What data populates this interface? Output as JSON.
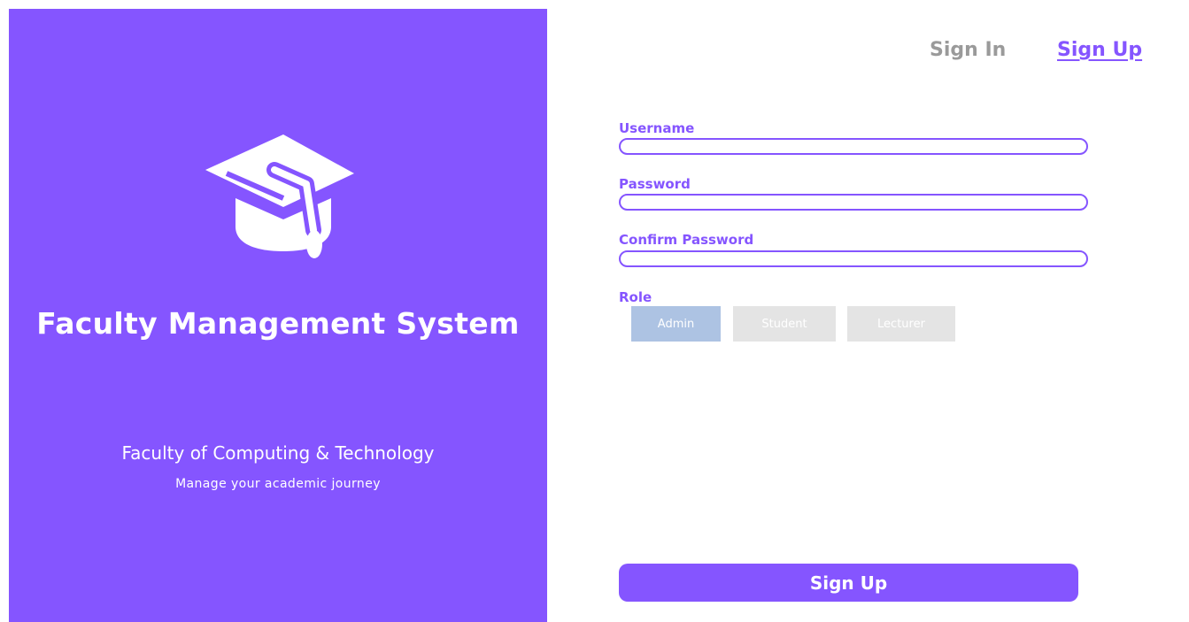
{
  "brand": {
    "title": "Faculty Management System",
    "faculty": "Faculty of Computing & Technology",
    "tagline": "Manage your academic journey",
    "icon": "graduation-cap-icon",
    "accent_color": "#8555ff"
  },
  "tabs": {
    "sign_in": "Sign In",
    "sign_up": "Sign Up",
    "active": "Sign Up"
  },
  "form": {
    "username": {
      "label": "Username",
      "value": ""
    },
    "password": {
      "label": "Password",
      "value": ""
    },
    "confirm_password": {
      "label": "Confirm Password",
      "value": ""
    },
    "role": {
      "label": "Role",
      "options": [
        "Admin",
        "Student",
        "Lecturer"
      ],
      "selected": "Admin",
      "selected_color": "#adc3e3",
      "unselected_color": "#e4e4e4"
    },
    "submit_label": "Sign Up"
  }
}
